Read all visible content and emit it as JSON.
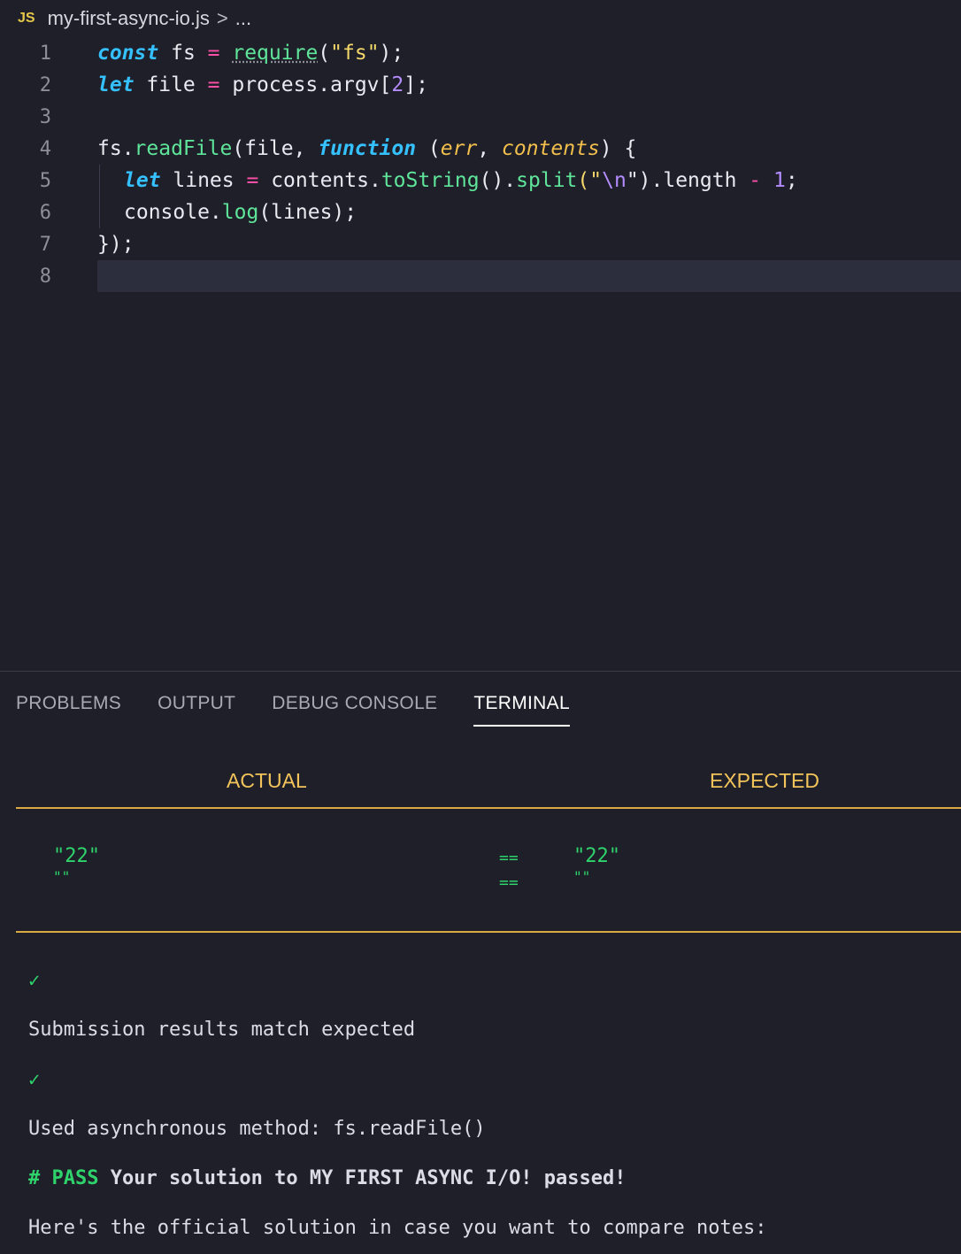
{
  "breadcrumb": {
    "file_icon": "JS",
    "file_name": "my-first-async-io.js",
    "separator": ">",
    "more": "..."
  },
  "editor": {
    "line_numbers": [
      "1",
      "2",
      "3",
      "4",
      "5",
      "6",
      "7",
      "8"
    ],
    "lines": {
      "l1": [
        "const",
        " fs ",
        "=",
        " ",
        "require",
        "(",
        "\"fs\"",
        ");"
      ],
      "l2": [
        "let",
        " file ",
        "=",
        " process.argv[",
        "2",
        "];"
      ],
      "l4": [
        "fs.",
        "readFile",
        "(file, ",
        "function",
        " (",
        "err",
        ", ",
        "contents",
        ") {"
      ],
      "l5": [
        "let",
        " lines ",
        "=",
        " contents.",
        "toString",
        "().",
        "split",
        "(\"",
        "\\n",
        "\").length ",
        "-",
        " ",
        "1",
        ";"
      ],
      "l6": [
        "console.",
        "log",
        "(lines);"
      ],
      "l7": [
        "});"
      ]
    }
  },
  "panel": {
    "tabs": [
      "PROBLEMS",
      "OUTPUT",
      "DEBUG CONSOLE",
      "TERMINAL"
    ],
    "active_tab": "TERMINAL",
    "compare": {
      "actual_header": "ACTUAL",
      "expected_header": "EXPECTED",
      "rows": [
        {
          "actual": "\"22\"",
          "op": "==",
          "expected": "\"22\""
        },
        {
          "actual": "\"\"",
          "op": "==",
          "expected": "\"\""
        }
      ]
    },
    "output": {
      "check1": "✓",
      "line1": "Submission results match expected",
      "check2": "✓",
      "line2": "Used asynchronous method: fs.readFile()",
      "pass_tag": "# PASS",
      "pass_text": " Your solution to MY FIRST ASYNC I/O! passed!",
      "line4": "Here's the official solution in case you want to compare notes:"
    }
  },
  "colors": {
    "background": "#1e1f29",
    "keyword": "#35c0ff",
    "operator": "#ff4fa6",
    "string": "#f5d86a",
    "function": "#5fe59a",
    "number": "#b48cff",
    "header": "#f2c45a",
    "pass_green": "#2fd36b"
  }
}
